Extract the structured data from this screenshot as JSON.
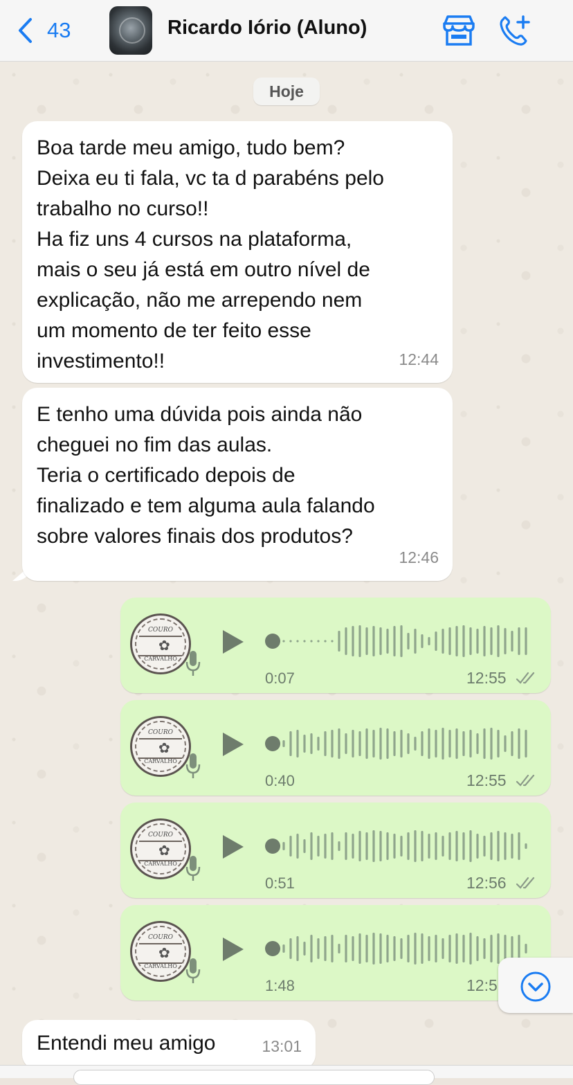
{
  "header": {
    "back_count": "43",
    "contact_name": "Ricardo Iório (Aluno)",
    "store_icon": "store-icon",
    "call_icon": "add-call-icon"
  },
  "date_separator": "Hoje",
  "incoming": [
    {
      "text": "Boa tarde meu amigo, tudo bem?\nDeixa eu ti fala, vc ta d parabéns pelo\ntrabalho no curso!!\nHa fiz uns 4 cursos na plataforma,\nmais o seu já está em outro nível de\nexplicação, não me arrependo nem\num momento de ter feito esse\ninvestimento!!",
      "time": "12:44"
    },
    {
      "text": "E tenho uma dúvida pois ainda não\ncheguei no fim das aulas.\nTeria o certificado depois de\nfinalizado e tem alguma aula falando\nsobre valores finais dos produtos?",
      "time": "12:46"
    },
    {
      "text": "Entendi meu amigo",
      "time": "13:01"
    }
  ],
  "voice_messages": [
    {
      "duration": "0:07",
      "time": "12:55",
      "progress": 0.0
    },
    {
      "duration": "0:40",
      "time": "12:55",
      "progress": 0.0
    },
    {
      "duration": "0:51",
      "time": "12:56",
      "progress": 0.0
    },
    {
      "duration": "1:48",
      "time": "12:5",
      "progress": 0.0
    }
  ],
  "voice_avatar": {
    "brand_top": "COURO",
    "brand_bottom": "CARVALHO"
  },
  "colors": {
    "accent": "#1a7cf2",
    "outgoing_bubble": "#dcf8c6",
    "incoming_bubble": "#ffffff",
    "chat_background": "#efeae2",
    "waveform": "#8fa58c"
  }
}
